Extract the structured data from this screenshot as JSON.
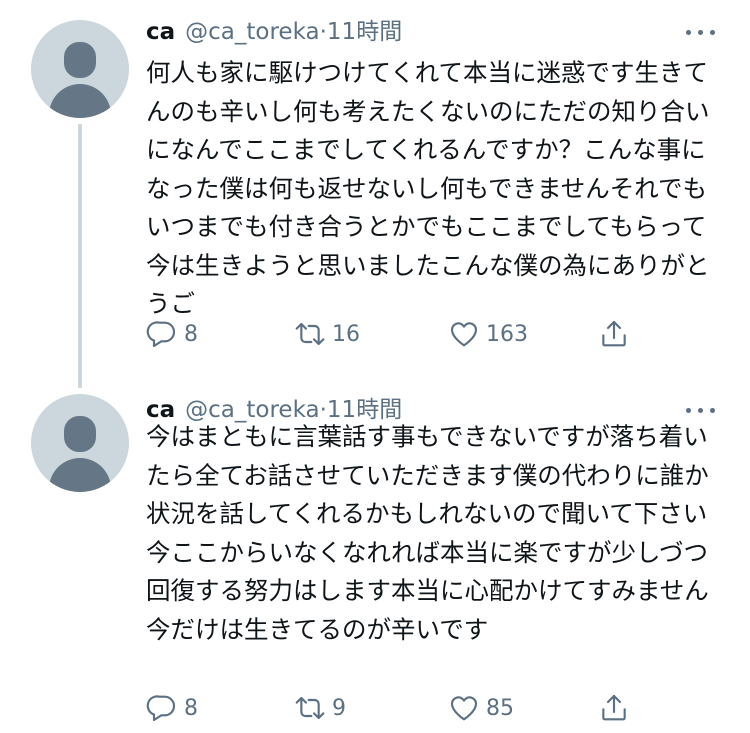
{
  "tweets": [
    {
      "name": "ca",
      "handle": "@ca_toreka",
      "separator": "·",
      "time": "11時間",
      "text": "何人も家に駆けつけてくれて本当に迷惑です生きてんのも辛いし何も考えたくないのにただの知り合いになんでここまでしてくれるんですか？こんな事になった僕は何も返せないし何もできませんそれでもいつまでも付き合うとかでもここまでしてもらって今は生きようと思いましたこんな僕の為にありがとうご",
      "replies": "8",
      "retweets": "16",
      "likes": "163"
    },
    {
      "name": "ca",
      "handle": "@ca_toreka",
      "separator": "·",
      "time": "11時間",
      "text": "今はまともに言葉話す事もできないですが落ち着いたら全てお話させていただきます僕の代わりに誰か状況を話してくれるかもしれないので聞いて下さい今ここからいなくなれれば本当に楽ですが少しづつ回復する努力はします本当に心配かけてすみません今だけは生きてるのが辛いです",
      "replies": "8",
      "retweets": "9",
      "likes": "85"
    }
  ],
  "icons": {
    "reply": "reply-icon",
    "retweet": "retweet-icon",
    "like": "heart-icon",
    "share": "share-icon",
    "more": "more-icon"
  },
  "colors": {
    "text": "#0f1419",
    "secondary": "#5b7083",
    "avatar_bg": "#ccd6dd",
    "avatar_fg": "#657786",
    "thread_line": "#ccd6dd"
  }
}
